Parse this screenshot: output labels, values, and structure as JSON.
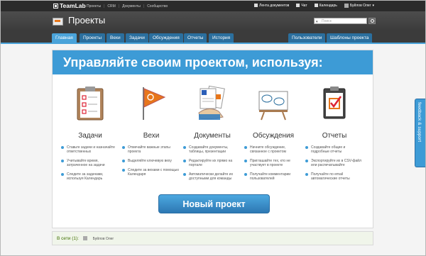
{
  "topbar": {
    "logo": "TeamLab",
    "links": [
      "Проекты",
      "CRM",
      "Документы",
      "Сообщество"
    ],
    "right": {
      "docs_feed": "Лента документов",
      "chat": "Чат",
      "calendar": "Календарь",
      "user": "Буйлов Олег"
    }
  },
  "header": {
    "title": "Проекты",
    "search_placeholder": "Поиск"
  },
  "tabs": [
    "Главная",
    "Проекты",
    "Вехи",
    "Задачи",
    "Обсуждения",
    "Отчеты",
    "История"
  ],
  "tabs_right": [
    "Пользователи",
    "Шаблоны проекта"
  ],
  "banner": "Управляйте своим проектом, используя:",
  "features": [
    {
      "title": "Задачи",
      "items": [
        "Ставьте задачи и назначайте ответственных",
        "Учитывайте время, затраченное на задачи",
        "Следите за задачами, используя Календарь"
      ]
    },
    {
      "title": "Вехи",
      "items": [
        "Отмечайте важные этапы проекта",
        "Выделяйте ключевую веху",
        "Следите за вехами с помощью Календаря"
      ]
    },
    {
      "title": "Документы",
      "items": [
        "Создавайте документы, таблицы, презентации",
        "Редактируйте их прямо на портале",
        "Автоматически делайте их доступными для команды"
      ]
    },
    {
      "title": "Обсуждения",
      "items": [
        "Начните обсуждение, связанное с проектом",
        "Приглашайте тех, кто не участвует в проекте",
        "Получайте комментарии пользователей"
      ]
    },
    {
      "title": "Отчеты",
      "items": [
        "Создавайте общие и подробные отчеты",
        "Экспортируйте их в CSV-файл или распечатывайте",
        "Получайте по email автоматические отчеты"
      ]
    }
  ],
  "new_project": "Новый проект",
  "online": {
    "label": "В сети (1):",
    "user": "Буйлов Олег"
  },
  "feedback": "feedback & support",
  "colors": {
    "accent": "#3d9bd6",
    "tab_dark": "#2b6f9e",
    "orange": "#e7761b"
  }
}
